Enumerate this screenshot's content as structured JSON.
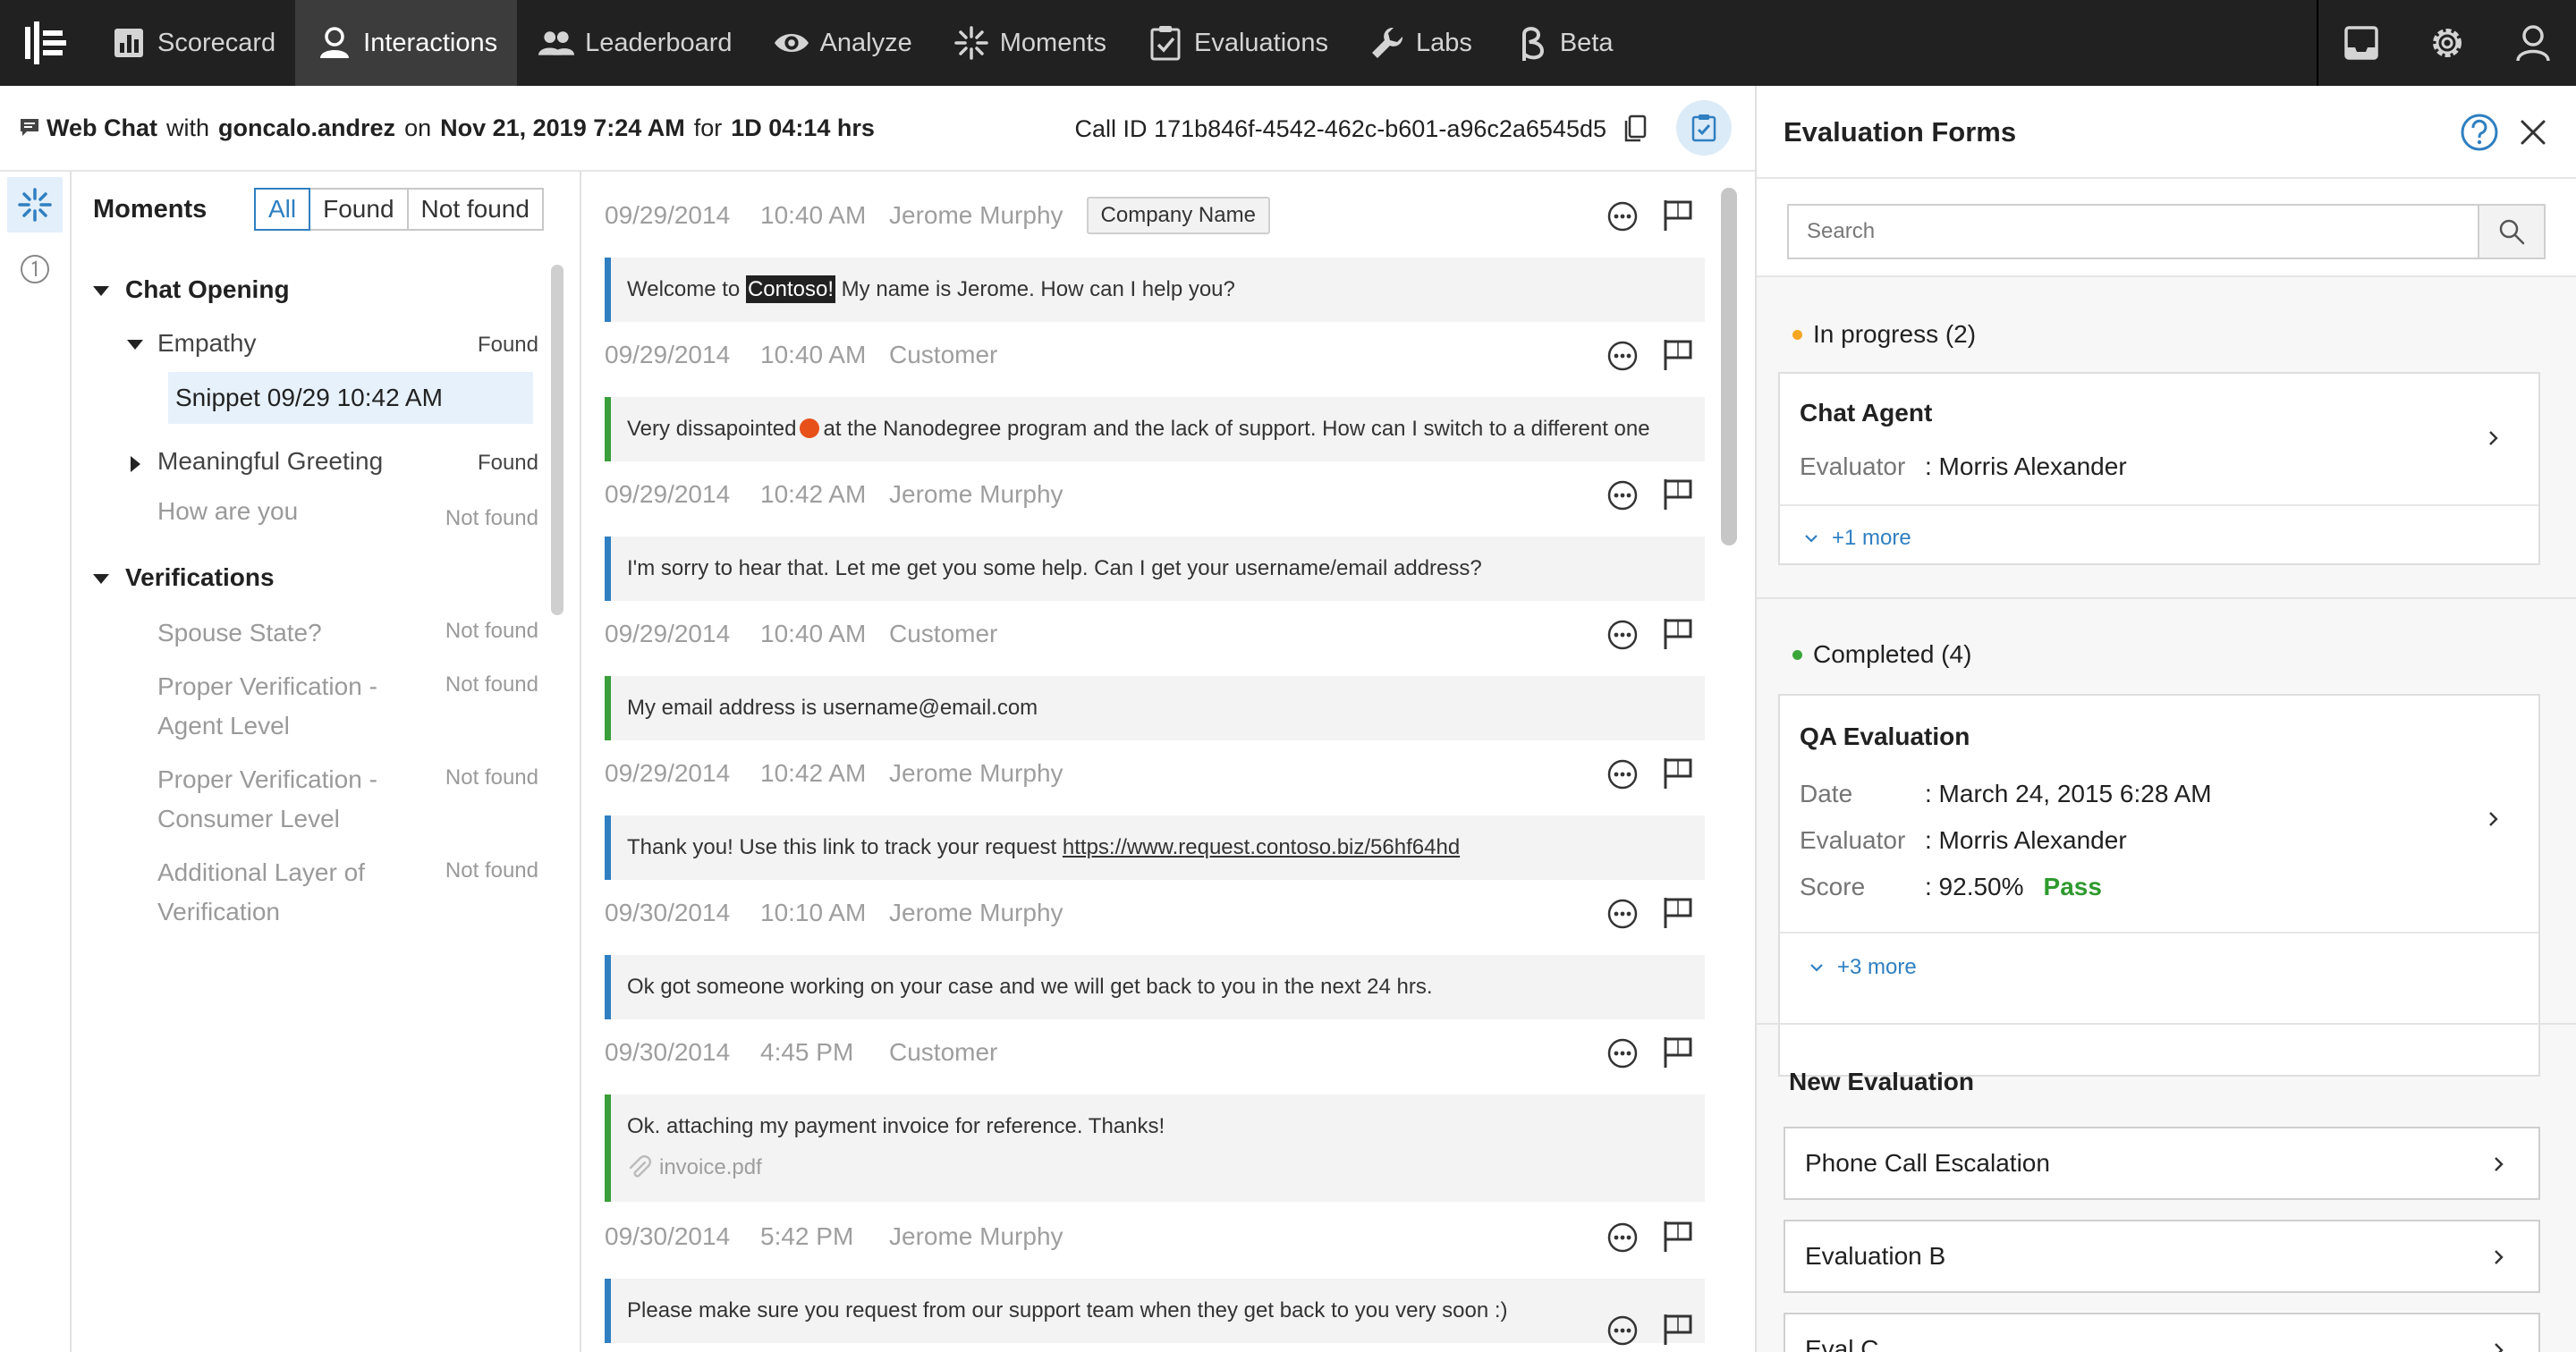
{
  "nav": {
    "items": [
      {
        "label": "Scorecard",
        "icon": "bar-chart-icon"
      },
      {
        "label": "Interactions",
        "icon": "user-icon",
        "active": true
      },
      {
        "label": "Leaderboard",
        "icon": "users-icon"
      },
      {
        "label": "Analyze",
        "icon": "eye-icon"
      },
      {
        "label": "Moments",
        "icon": "sparkle-icon"
      },
      {
        "label": "Evaluations",
        "icon": "clipboard-check-icon"
      },
      {
        "label": "Labs",
        "icon": "wrench-icon"
      },
      {
        "label": "Beta",
        "icon": "beta-icon"
      }
    ],
    "right_icons": [
      "inbox-icon",
      "gear-icon",
      "user-icon"
    ]
  },
  "interaction": {
    "channel": "Web Chat",
    "with_label": "with",
    "user": "goncalo.andrez",
    "on_label": "on",
    "datetime": "Nov 21, 2019 7:24 AM",
    "for_label": "for",
    "duration": "1D 04:14 hrs",
    "call_id_label": "Call ID",
    "call_id": "171b846f-4542-462c-b601-a96c2a6545d5"
  },
  "moments": {
    "title": "Moments",
    "filters": [
      {
        "label": "All",
        "active": true
      },
      {
        "label": "Found",
        "active": false
      },
      {
        "label": "Not found",
        "active": false
      }
    ],
    "groups": {
      "chat_opening": {
        "label": "Chat Opening",
        "empathy": {
          "label": "Empathy",
          "status": "Found",
          "snippet": "Snippet 09/29 10:42 AM"
        },
        "greeting": {
          "label": "Meaningful Greeting",
          "status": "Found"
        },
        "how_are_you": {
          "label": "How are you",
          "status": "Not found"
        }
      },
      "verifications": {
        "label": "Verifications",
        "spouse": {
          "label": "Spouse State?",
          "status": "Not found"
        },
        "agent_level": {
          "label": "Proper Verification - Agent Level",
          "status": "Not found"
        },
        "consumer_level": {
          "label": "Proper Verification - Consumer Level",
          "status": "Not found"
        },
        "additional": {
          "label": "Additional Layer of Verification",
          "status": "Not found"
        }
      }
    }
  },
  "messages": [
    {
      "date": "09/29/2014",
      "time": "10:40 AM",
      "who": "Jerome Murphy",
      "tag": "Company Name",
      "role": "agent",
      "pre": "Welcome to",
      "highlight": "Contoso!",
      "post": " My name is Jerome. How can I help you?"
    },
    {
      "date": "09/29/2014",
      "time": "10:40 AM",
      "who": "Customer",
      "role": "customer",
      "pre": "Very dissapointed",
      "post": "at the Nanodegree program and the lack of support. How can I switch to a different one"
    },
    {
      "date": "09/29/2014",
      "time": "10:42 AM",
      "who": "Jerome Murphy",
      "role": "agent",
      "text": "I'm sorry to hear that. Let me get you some help. Can I get your username/email address?"
    },
    {
      "date": "09/29/2014",
      "time": "10:40 AM",
      "who": "Customer",
      "role": "customer",
      "text": "My email address is username@email.com"
    },
    {
      "date": "09/29/2014",
      "time": "10:42 AM",
      "who": "Jerome Murphy",
      "role": "agent",
      "pre": "Thank you! Use this link to track your request ",
      "link": "https://www.request.contoso.biz/56hf64hd"
    },
    {
      "date": "09/30/2014",
      "time": "10:10 AM",
      "who": "Jerome Murphy",
      "role": "agent",
      "text": "Ok got someone working on your case and we will get back to you in the next 24 hrs."
    },
    {
      "date": "09/30/2014",
      "time": "4:45 PM",
      "who": "Customer",
      "role": "customer",
      "text": "Ok. attaching my payment invoice for reference. Thanks!",
      "attachment": "invoice.pdf"
    },
    {
      "date": "09/30/2014",
      "time": "5:42 PM",
      "who": "Jerome Murphy",
      "role": "agent",
      "text": "Please make sure you request from our support team when they get back to you very soon :)"
    }
  ],
  "eval_panel": {
    "title": "Evaluation Forms",
    "search_placeholder": "Search",
    "in_progress": {
      "label": "In progress (2)",
      "dot_color": "#f5a623",
      "card": {
        "title": "Chat Agent",
        "evaluator_label": "Evaluator",
        "evaluator": ": Morris Alexander",
        "more": "+1 more"
      }
    },
    "completed": {
      "label": "Completed (4)",
      "dot_color": "#3aa63a",
      "card": {
        "title": "QA Evaluation",
        "date_label": "Date",
        "date": ": March 24, 2015 6:28 AM",
        "evaluator_label": "Evaluator",
        "evaluator": ": Morris Alexander",
        "score_label": "Score",
        "score": ": 92.50%",
        "result": "Pass",
        "more": "+3 more"
      }
    },
    "new_evaluation": {
      "label": "New Evaluation",
      "items": [
        "Phone Call Escalation",
        "Evaluation B",
        "Eval C"
      ]
    }
  }
}
